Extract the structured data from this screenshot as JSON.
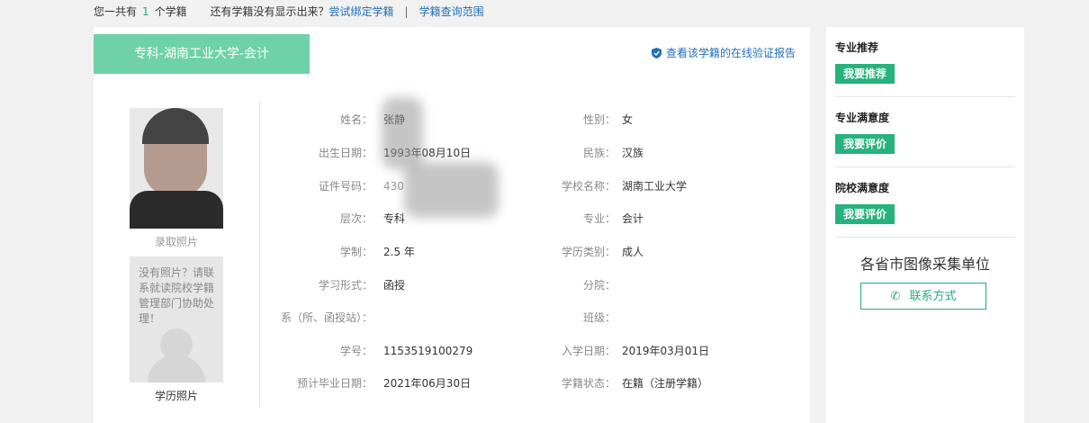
{
  "topbar": {
    "prefix": "您一共有",
    "count": "1",
    "suffix": "个学籍",
    "question": "还有学籍没有显示出来？",
    "bind_link": "尝试绑定学籍",
    "separator": "|",
    "scope_link": "学籍查询范围"
  },
  "card": {
    "tab_title": "专科-湖南工业大学-会计",
    "verify_link": "查看该学籍的在线验证报告"
  },
  "photos": {
    "admission_caption": "录取照片",
    "no_photo_text": "没有照片？请联系就读院校学籍管理部门协助处理！",
    "education_caption": "学历照片"
  },
  "fields": {
    "name": {
      "label": "姓名：",
      "value": "张静"
    },
    "gender": {
      "label": "性别：",
      "value": "女"
    },
    "birth": {
      "label": "出生日期：",
      "value": "1993年08月10日"
    },
    "ethnicity": {
      "label": "民族：",
      "value": "汉族"
    },
    "id_no": {
      "label": "证件号码：",
      "value": "430"
    },
    "school": {
      "label": "学校名称：",
      "value": "湖南工业大学"
    },
    "level": {
      "label": "层次：",
      "value": "专科"
    },
    "major": {
      "label": "专业：",
      "value": "会计"
    },
    "duration": {
      "label": "学制：",
      "value": "2.5 年"
    },
    "edu_type": {
      "label": "学历类别：",
      "value": "成人"
    },
    "study_form": {
      "label": "学习形式：",
      "value": "函授"
    },
    "branch": {
      "label": "分院：",
      "value": ""
    },
    "department": {
      "label": "系（所、函授站）：",
      "value": ""
    },
    "class": {
      "label": "班级：",
      "value": ""
    },
    "student_no": {
      "label": "学号：",
      "value": "1153519100279"
    },
    "enroll_date": {
      "label": "入学日期：",
      "value": "2019年03月01日"
    },
    "grad_date": {
      "label": "预计毕业日期：",
      "value": "2021年06月30日"
    },
    "status": {
      "label": "学籍状态：",
      "value": "在籍（注册学籍）"
    }
  },
  "sidebar": {
    "recommend_title": "专业推荐",
    "recommend_btn": "我要推荐",
    "major_sat_title": "专业满意度",
    "major_sat_btn": "我要评价",
    "school_sat_title": "院校满意度",
    "school_sat_btn": "我要评价",
    "unit_title": "各省市图像采集单位",
    "contact_btn": "联系方式"
  },
  "colors": {
    "accent": "#27b27e",
    "tab": "#6fd1a7",
    "link": "#1f6fb5"
  }
}
